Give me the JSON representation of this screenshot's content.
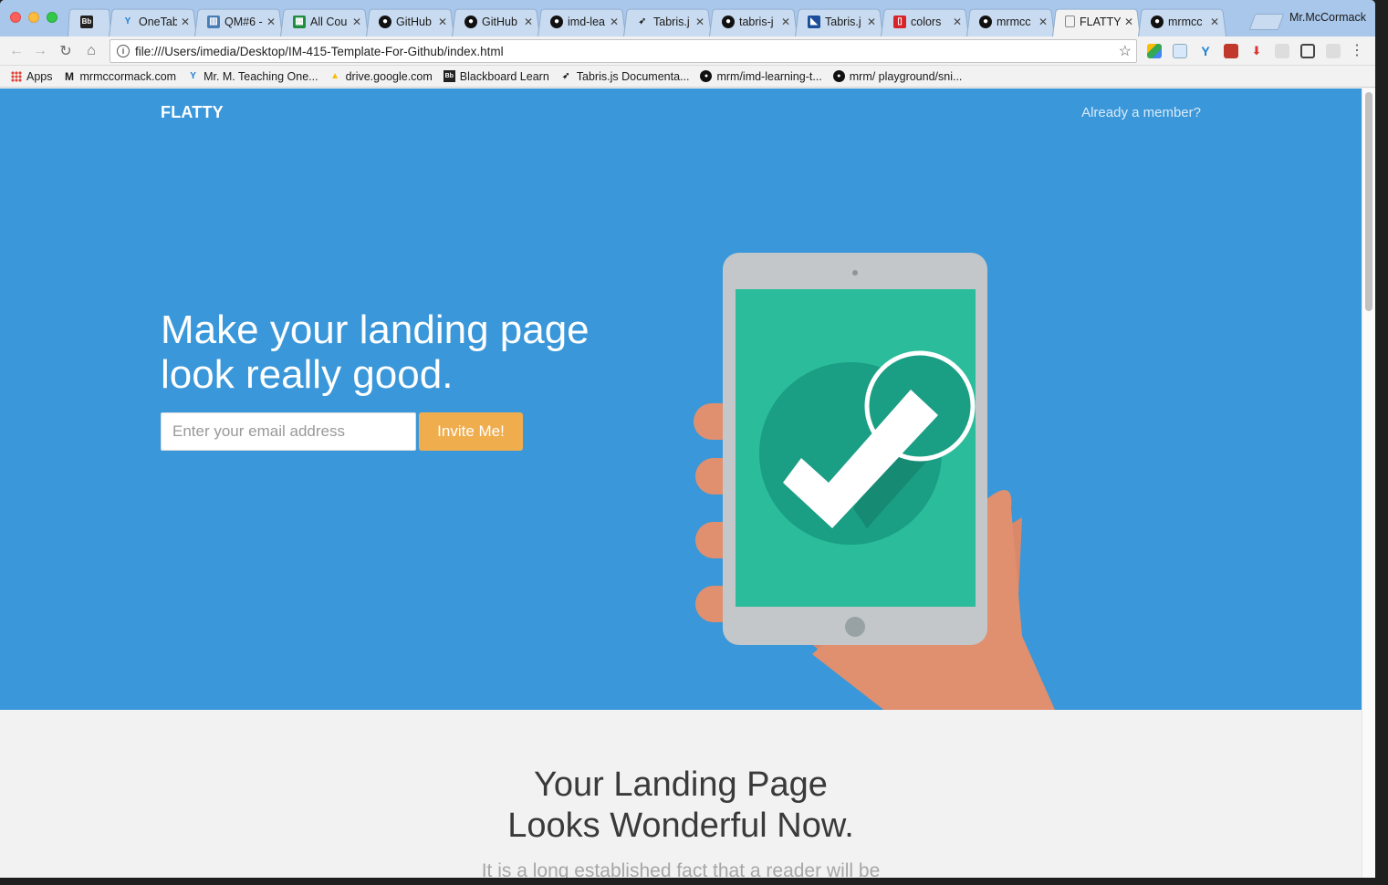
{
  "browser": {
    "profile_name": "Mr.McCormack",
    "tabs": [
      {
        "title": "",
        "icon": "blackboard-icon"
      },
      {
        "title": "OneTab",
        "icon": "onetab-icon"
      },
      {
        "title": "QM#6 -",
        "icon": "trello-icon"
      },
      {
        "title": "All Cou",
        "icon": "sheets-icon"
      },
      {
        "title": "GitHub",
        "icon": "github-icon"
      },
      {
        "title": "GitHub",
        "icon": "github-icon"
      },
      {
        "title": "imd-lea",
        "icon": "github-icon"
      },
      {
        "title": "Tabris.j",
        "icon": "tabris-icon"
      },
      {
        "title": "tabris-j",
        "icon": "github-icon"
      },
      {
        "title": "Tabris.j",
        "icon": "tabris-blue-icon"
      },
      {
        "title": "colors",
        "icon": "colors-icon"
      },
      {
        "title": "mrmcc",
        "icon": "github-icon"
      },
      {
        "title": "FLATTY",
        "icon": "page-icon"
      },
      {
        "title": "mrmcc",
        "icon": "github-icon"
      }
    ],
    "address": "file:///Users/imedia/Desktop/IM-415-Template-For-Github/index.html",
    "bookmarks": [
      {
        "label": "Apps",
        "icon": "apps-icon"
      },
      {
        "label": "mrmccormack.com",
        "icon": "m-logo-icon"
      },
      {
        "label": "Mr. M. Teaching One...",
        "icon": "onetab-icon"
      },
      {
        "label": "drive.google.com",
        "icon": "drive-icon"
      },
      {
        "label": "Blackboard Learn",
        "icon": "blackboard-icon"
      },
      {
        "label": "Tabris.js Documenta...",
        "icon": "tabris-icon"
      },
      {
        "label": "mrm/imd-learning-t...",
        "icon": "github-icon"
      },
      {
        "label": "mrm/ playground/sni...",
        "icon": "github-icon"
      }
    ]
  },
  "page": {
    "brand": "FLATTY",
    "member_link": "Already a member?",
    "headline_line1": "Make your landing page",
    "headline_line2": "look really good.",
    "email_placeholder": "Enter your email address",
    "invite_button": "Invite Me!",
    "section2_line1": "Your Landing Page",
    "section2_line2": "Looks Wonderful Now.",
    "section2_lead": "It is a long established fact that a reader will be"
  },
  "colors": {
    "hero_bg": "#3a97d9",
    "button": "#f0ad4e",
    "screen": "#2bbc9c",
    "skin": "#e0906e"
  }
}
